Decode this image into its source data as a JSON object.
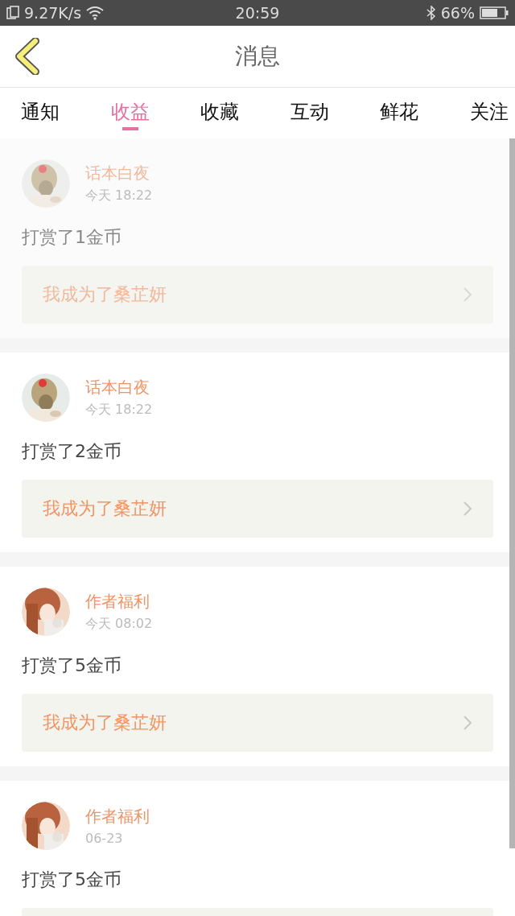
{
  "status_bar": {
    "speed": "9.27K/s",
    "time": "20:59",
    "battery": "66%"
  },
  "header": {
    "title": "消息"
  },
  "tabs": [
    {
      "label": "通知",
      "selected": false
    },
    {
      "label": "收益",
      "selected": true
    },
    {
      "label": "收藏",
      "selected": false
    },
    {
      "label": "互动",
      "selected": false
    },
    {
      "label": "鲜花",
      "selected": false
    },
    {
      "label": "关注",
      "selected": false
    }
  ],
  "messages": [
    {
      "name": "话本白夜",
      "time": "今天 18:22",
      "text": "打赏了1金币",
      "link": "我成为了桑芷妍",
      "faded": true
    },
    {
      "name": "话本白夜",
      "time": "今天 18:22",
      "text": "打赏了2金币",
      "link": "我成为了桑芷妍",
      "faded": false
    },
    {
      "name": "作者福利",
      "time": "今天 08:02",
      "text": "打赏了5金币",
      "link": "我成为了桑芷妍",
      "faded": false
    },
    {
      "name": "作者福利",
      "time": "06-23",
      "text": "打赏了5金币",
      "faded": false
    }
  ]
}
